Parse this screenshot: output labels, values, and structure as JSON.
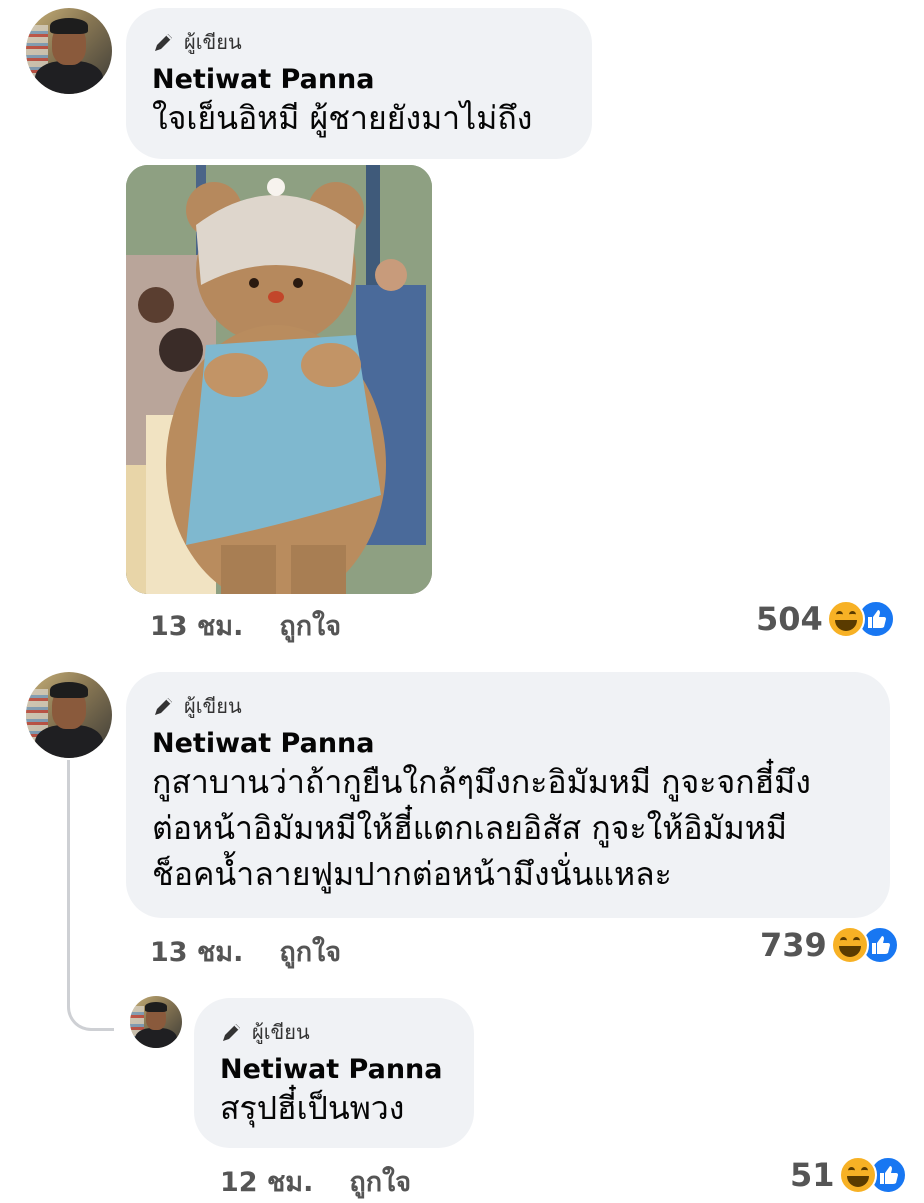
{
  "comments": [
    {
      "author_badge": "ผู้เขียน",
      "author_name": "Netiwat Panna",
      "text": "ใจเย็นอิหมี ผู้ชายยังมาไม่ถึง",
      "time": "13 ชม.",
      "like_label": "ถูกใจ",
      "reaction_count": "504",
      "reactions": [
        "haha-icon",
        "like-icon"
      ]
    },
    {
      "author_badge": "ผู้เขียน",
      "author_name": "Netiwat Panna",
      "text_lines": [
        "กูสาบานว่าถ้ากูยืนใกล้ๆมึงกะอิมัมหมี กูจะจกฮี๋มึง",
        "ต่อหน้าอิมัมหมีให้ฮี๋แตกเลยอิสัส กูจะให้อิมัมหมี",
        "ช็อคน้ำลายฟูมปากต่อหน้ามึงนั่นแหละ"
      ],
      "time": "13 ชม.",
      "like_label": "ถูกใจ",
      "reaction_count": "739",
      "reactions": [
        "haha-icon",
        "like-icon"
      ]
    },
    {
      "author_badge": "ผู้เขียน",
      "author_name": "Netiwat Panna",
      "text": "สรุปฮี๋เป็นพวง",
      "time": "12 ชม.",
      "like_label": "ถูกใจ",
      "reaction_count": "51",
      "reactions": [
        "haha-icon",
        "like-icon"
      ]
    }
  ],
  "colors": {
    "bubble": "#f0f2f5",
    "meta_text": "#555555",
    "like_blue": "#1877f2",
    "haha_yellow": "#f7b125"
  }
}
